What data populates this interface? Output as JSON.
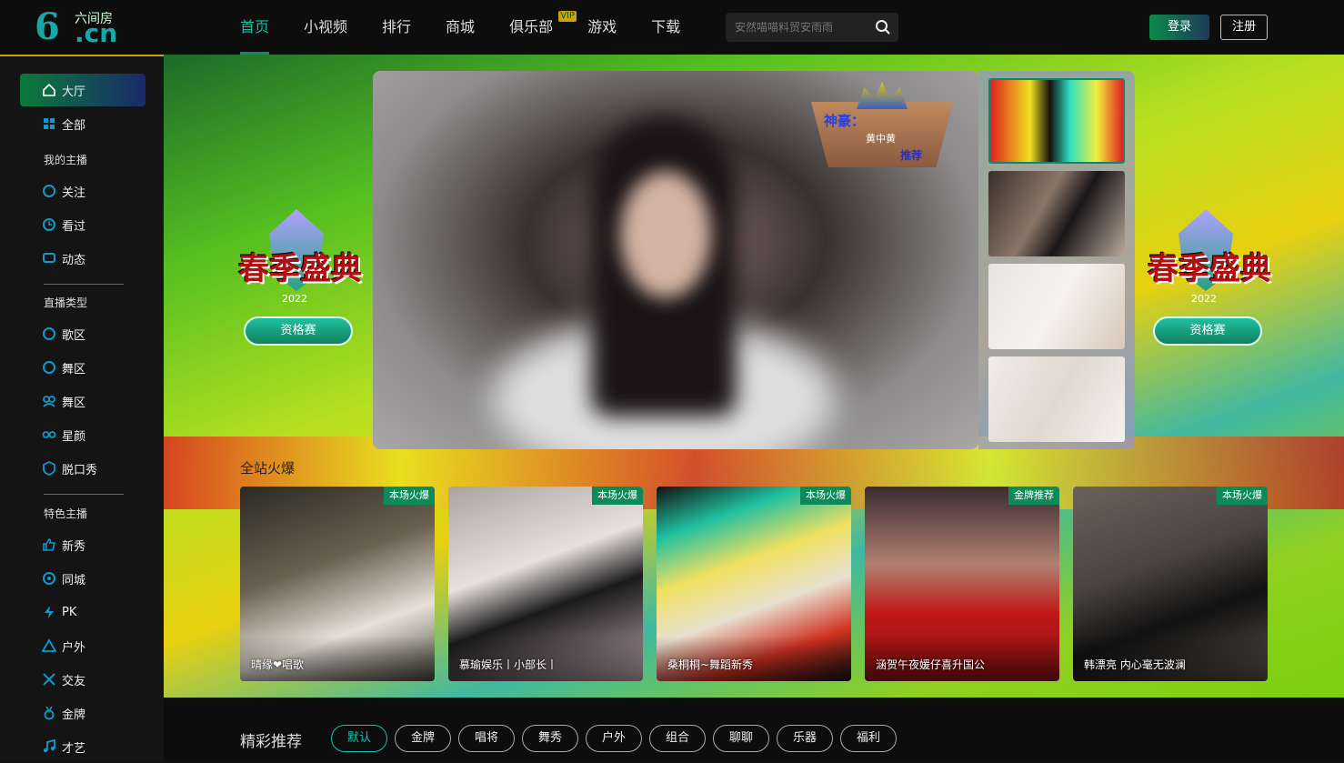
{
  "logo": {
    "top_text": "六间房",
    "main_text": ".cn",
    "mark": "6"
  },
  "nav": {
    "items": [
      {
        "label": "首页",
        "active": true
      },
      {
        "label": "小视频"
      },
      {
        "label": "排行"
      },
      {
        "label": "商城"
      },
      {
        "label": "俱乐部",
        "badge": "VIP"
      },
      {
        "label": "游戏"
      },
      {
        "label": "下载"
      }
    ]
  },
  "search": {
    "placeholder": "安然喵喵料贸安雨雨"
  },
  "auth": {
    "login": "登录",
    "register": "注册"
  },
  "sidebar": {
    "home": "大厅",
    "all": "全部",
    "my_head": "我的主播",
    "my_items": [
      "关注",
      "看过",
      "动态"
    ],
    "type_head": "直播类型",
    "type_items": [
      "歌区",
      "舞区",
      "舞区",
      "星颜",
      "脱口秀"
    ],
    "special_head": "特色主播",
    "special_items": [
      "新秀",
      "同城",
      "PK",
      "户外",
      "交友",
      "金牌",
      "才艺"
    ]
  },
  "banner": {
    "emblem_title": "春季盛典",
    "emblem_year": "2022",
    "emblem_pill": "资格赛"
  },
  "player": {
    "badge_title": "神豪：",
    "badge_name": "黄中黄",
    "badge_tag": "推荐"
  },
  "hot": {
    "title": "全站火爆",
    "cards": [
      {
        "tag": "本场火爆",
        "name": "晴缘❤唱歌"
      },
      {
        "tag": "本场火爆",
        "name": "慕瑜娱乐丨小部长丨"
      },
      {
        "tag": "本场火爆",
        "name": "桑桐桐~舞蹈新秀"
      },
      {
        "tag": "金牌推荐",
        "name": "涵贺午夜媛仔喜升国公"
      },
      {
        "tag": "本场火爆",
        "name": "韩漂亮 内心毫无波澜"
      }
    ]
  },
  "recommend": {
    "title": "精彩推荐",
    "chips": [
      "默认",
      "金牌",
      "唱将",
      "舞秀",
      "户外",
      "组合",
      "聊聊",
      "乐器",
      "福利"
    ]
  },
  "colors": {
    "accent": "#13c2a0",
    "brand": "#19a8a8",
    "tag_green": "#0e8a5a",
    "vip": "#caa20d"
  }
}
